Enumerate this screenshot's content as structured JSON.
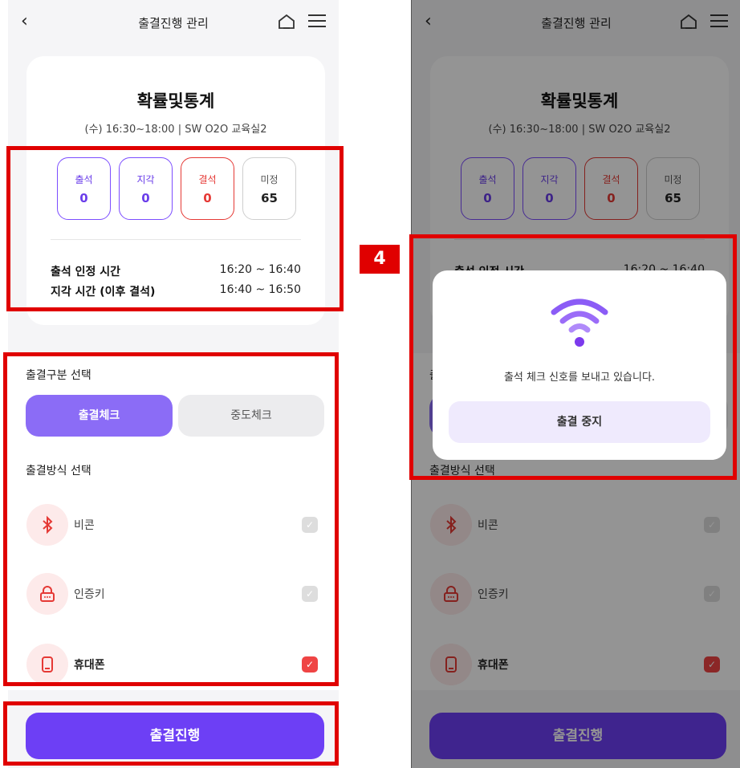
{
  "header": {
    "back": "‹",
    "title": "출결진행 관리"
  },
  "course": {
    "name": "확률및통계",
    "schedule": "(수) 16:30~18:00 | SW O2O 교육실2"
  },
  "stats": [
    {
      "label": "출석",
      "value": "0"
    },
    {
      "label": "지각",
      "value": "0"
    },
    {
      "label": "결석",
      "value": "0"
    },
    {
      "label": "미정",
      "value": "65"
    }
  ],
  "times": [
    {
      "key": "출석 인정 시간",
      "value": "16:20 ~ 16:40"
    },
    {
      "key": "지각 시간 (이후 결석)",
      "value": "16:40 ~ 16:50"
    }
  ],
  "type_section": {
    "label": "출결구분 선택",
    "options": [
      "출결체크",
      "중도체크"
    ],
    "selected": "출결체크"
  },
  "method_section": {
    "label": "출결방식 선택",
    "options": [
      {
        "label": "비콘",
        "checked": false
      },
      {
        "label": "인증키",
        "checked": false
      },
      {
        "label": "휴대폰",
        "checked": true
      }
    ]
  },
  "cta": "출결진행",
  "modal": {
    "message": "출석 체크 신호를 보내고 있습니다.",
    "button": "출결 중지"
  },
  "annotation": {
    "step": "4"
  },
  "colors": {
    "accent": "#6d3ff5",
    "red": "#e53935",
    "highlight": "#e00000"
  }
}
